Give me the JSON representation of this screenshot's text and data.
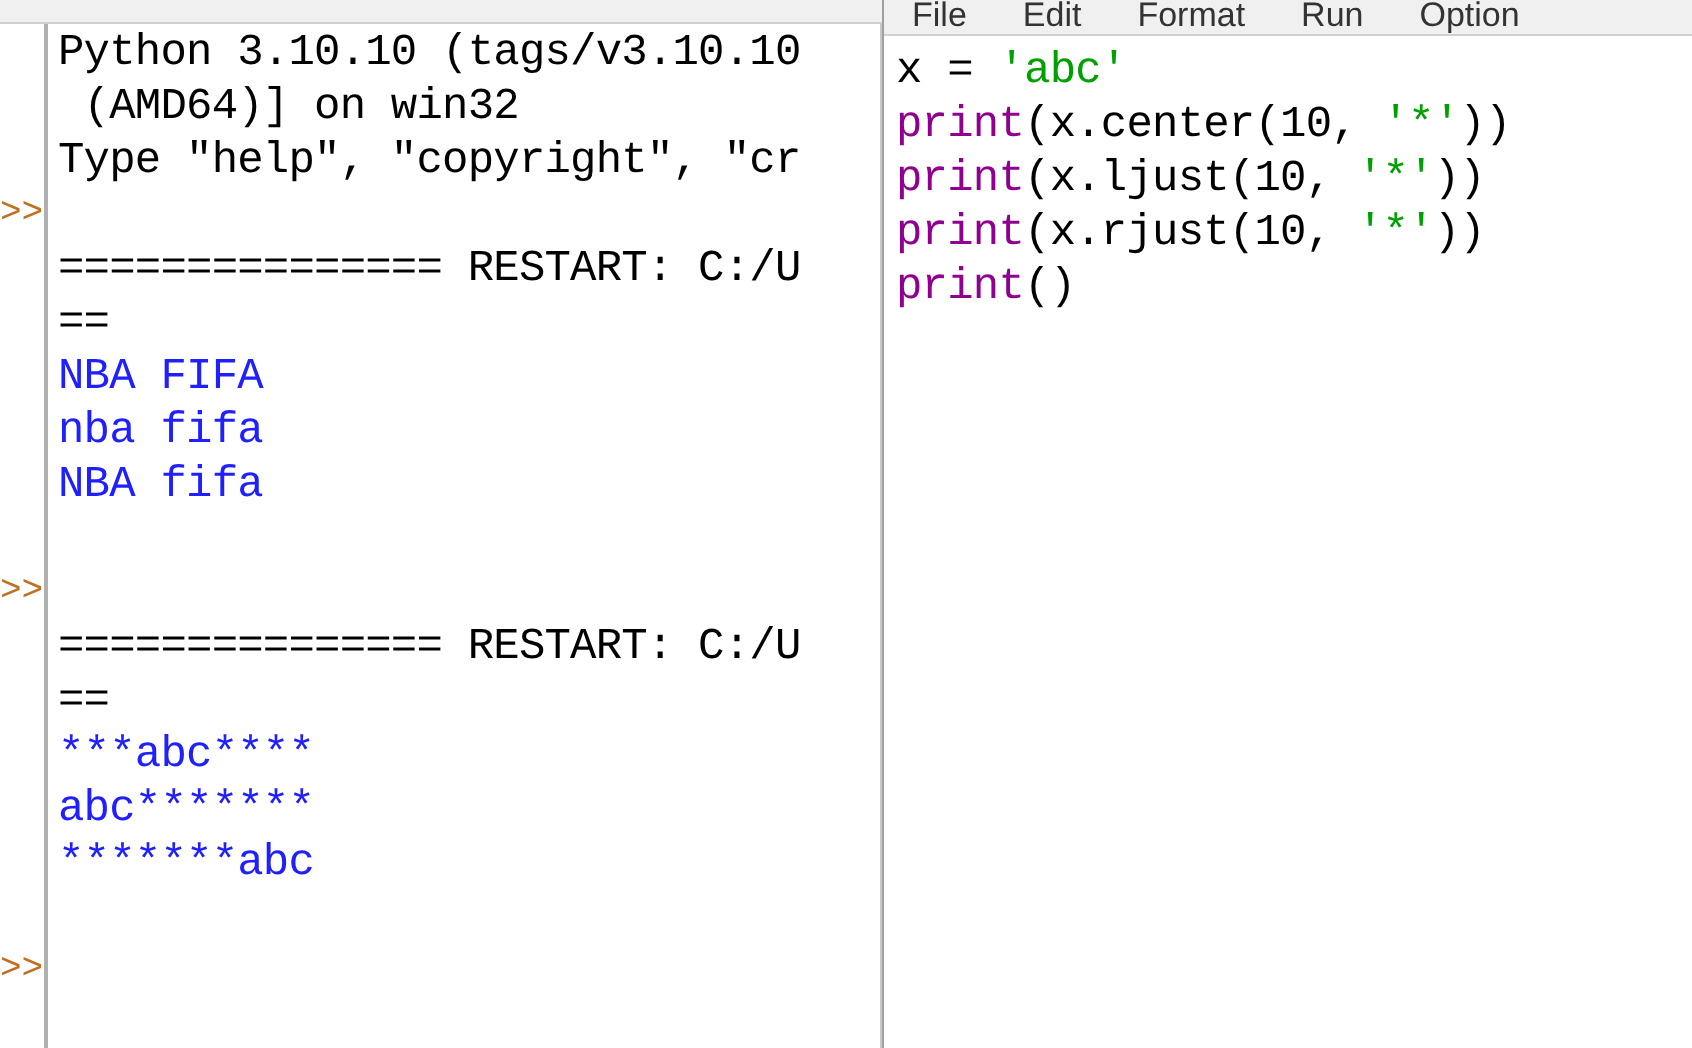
{
  "shell": {
    "lines": [
      {
        "text": "Python 3.10.10 (tags/v3.10.10",
        "kind": "info"
      },
      {
        "text": " (AMD64)] on win32",
        "kind": "info"
      },
      {
        "text": "Type \"help\", \"copyright\", \"cr",
        "kind": "info"
      },
      {
        "kind": "prompt"
      },
      {
        "text": "=============== RESTART: C:/U",
        "kind": "info"
      },
      {
        "text": "==",
        "kind": "info"
      },
      {
        "text": "NBA FIFA",
        "kind": "output"
      },
      {
        "text": "nba fifa",
        "kind": "output"
      },
      {
        "text": "NBA fifa",
        "kind": "output"
      },
      {
        "kind": "blank"
      },
      {
        "kind": "prompt"
      },
      {
        "text": "=============== RESTART: C:/U",
        "kind": "info"
      },
      {
        "text": "==",
        "kind": "info"
      },
      {
        "text": "***abc****",
        "kind": "output"
      },
      {
        "text": "abc*******",
        "kind": "output"
      },
      {
        "text": "*******abc",
        "kind": "output"
      },
      {
        "kind": "blank"
      },
      {
        "kind": "prompt"
      }
    ],
    "prompt_symbol": ">>"
  },
  "editor": {
    "menu": [
      "File",
      "Edit",
      "Format",
      "Run",
      "Option"
    ],
    "code": [
      [
        {
          "text": "x = ",
          "kind": "plain"
        },
        {
          "text": "'abc'",
          "kind": "string"
        }
      ],
      [
        {
          "text": "print",
          "kind": "builtin"
        },
        {
          "text": "(x.center(10, ",
          "kind": "plain"
        },
        {
          "text": "'*'",
          "kind": "string"
        },
        {
          "text": "))",
          "kind": "plain"
        }
      ],
      [
        {
          "text": "print",
          "kind": "builtin"
        },
        {
          "text": "(x.ljust(10, ",
          "kind": "plain"
        },
        {
          "text": "'*'",
          "kind": "string"
        },
        {
          "text": "))",
          "kind": "plain"
        }
      ],
      [
        {
          "text": "print",
          "kind": "builtin"
        },
        {
          "text": "(x.rjust(10, ",
          "kind": "plain"
        },
        {
          "text": "'*'",
          "kind": "string"
        },
        {
          "text": "))",
          "kind": "plain"
        }
      ],
      [
        {
          "text": "print",
          "kind": "builtin"
        },
        {
          "text": "()",
          "kind": "plain"
        }
      ]
    ]
  }
}
